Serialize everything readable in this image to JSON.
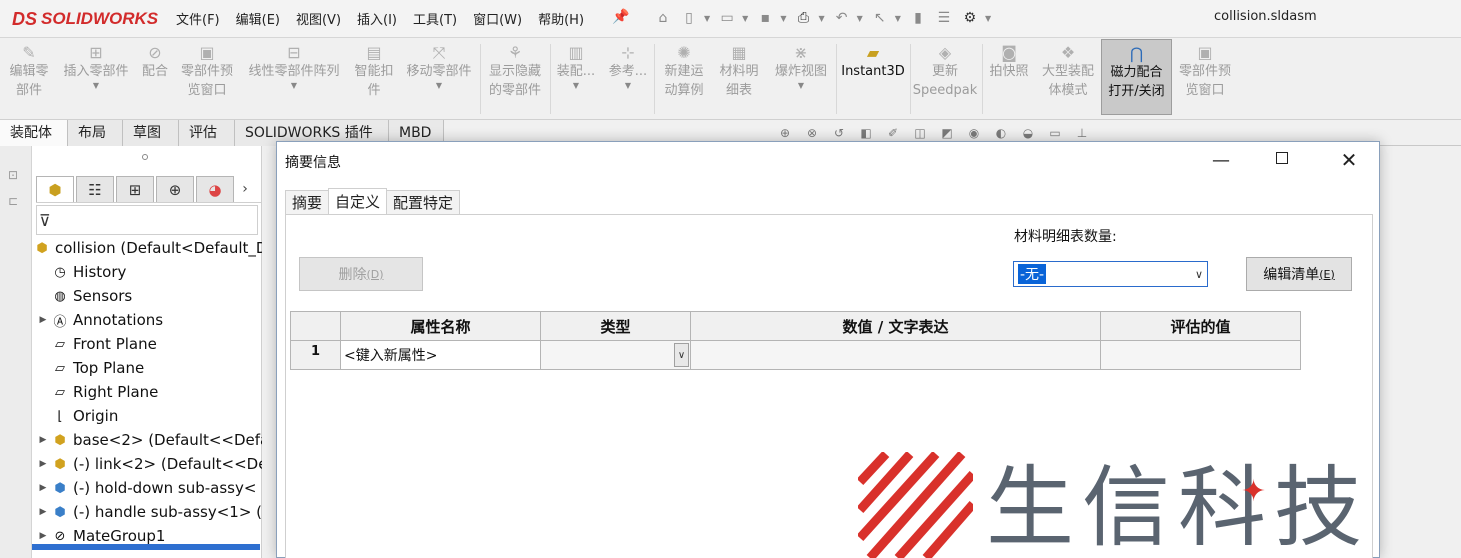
{
  "app": {
    "logo_mark": "DS",
    "logo_text": "SOLIDWORKS",
    "document_title": "collision.sldasm"
  },
  "menu": [
    "文件(F)",
    "编辑(E)",
    "视图(V)",
    "插入(I)",
    "工具(T)",
    "窗口(W)",
    "帮助(H)"
  ],
  "ribbon": {
    "edit_component": "编辑零\n部件",
    "insert_components": "插入零部件",
    "mate": "配合",
    "component_preview": "零部件预\n览窗口",
    "linear_pattern": "线性零部件阵列",
    "smart_fasteners": "智能扣\n件",
    "move_component": "移动零部件",
    "show_hidden": "显示隐藏\n的零部件",
    "assembly_features": "装配...",
    "reference_geometry": "参考...",
    "new_motion_study": "新建运\n动算例",
    "bom": "材料明\n细表",
    "exploded_view": "爆炸视图",
    "instant3d": "Instant3D",
    "update_speedpak": "更新\nSpeedpak",
    "take_snapshot": "拍快照",
    "large_assembly_mode": "大型装配\n体模式",
    "magnetic_mates": "磁力配合\n打开/关闭",
    "component_preview_2": "零部件预\n览窗口"
  },
  "command_tabs": [
    "装配体",
    "布局",
    "草图",
    "评估",
    "SOLIDWORKS 插件",
    "MBD"
  ],
  "tree": {
    "root": "collision  (Default<Default_D",
    "items": [
      {
        "label": "History",
        "icon": "history-icon",
        "expandable": false
      },
      {
        "label": "Sensors",
        "icon": "sensors-icon",
        "expandable": false
      },
      {
        "label": "Annotations",
        "icon": "annotations-icon",
        "expandable": true
      },
      {
        "label": "Front Plane",
        "icon": "plane-icon",
        "expandable": false
      },
      {
        "label": "Top Plane",
        "icon": "plane-icon",
        "expandable": false
      },
      {
        "label": "Right Plane",
        "icon": "plane-icon",
        "expandable": false
      },
      {
        "label": "Origin",
        "icon": "origin-icon",
        "expandable": false
      },
      {
        "label": "base<2> (Default<<Defa",
        "icon": "part-icon",
        "expandable": true
      },
      {
        "label": "(-) link<2> (Default<<De",
        "icon": "part-icon",
        "expandable": true
      },
      {
        "label": "(-) hold-down sub-assy<",
        "icon": "subassembly-icon",
        "expandable": true
      },
      {
        "label": "(-) handle sub-assy<1> (I",
        "icon": "subassembly-icon",
        "expandable": true
      },
      {
        "label": "MateGroup1",
        "icon": "mategroup-icon",
        "expandable": true
      }
    ]
  },
  "dialog": {
    "title": "摘要信息",
    "tabs": [
      "摘要",
      "自定义",
      "配置特定"
    ],
    "active_tab": "自定义",
    "bom_quantity_label": "材料明细表数量:",
    "bom_quantity_value": "-无-",
    "delete_label": "删除",
    "delete_hotkey": "(D)",
    "edit_list_label": "编辑清单",
    "edit_list_hotkey": "(E)",
    "columns": [
      "属性名称",
      "类型",
      "数值 / 文字表达",
      "评估的值"
    ],
    "rows": [
      {
        "num": "1",
        "name": "<键入新属性>",
        "type": "",
        "value": "",
        "evaluated": ""
      }
    ]
  },
  "watermark": {
    "text": "生信科技"
  },
  "colors": {
    "accent": "#0a64d8",
    "logo_red": "#d22b2b",
    "watermark_gray": "#5a6470"
  }
}
